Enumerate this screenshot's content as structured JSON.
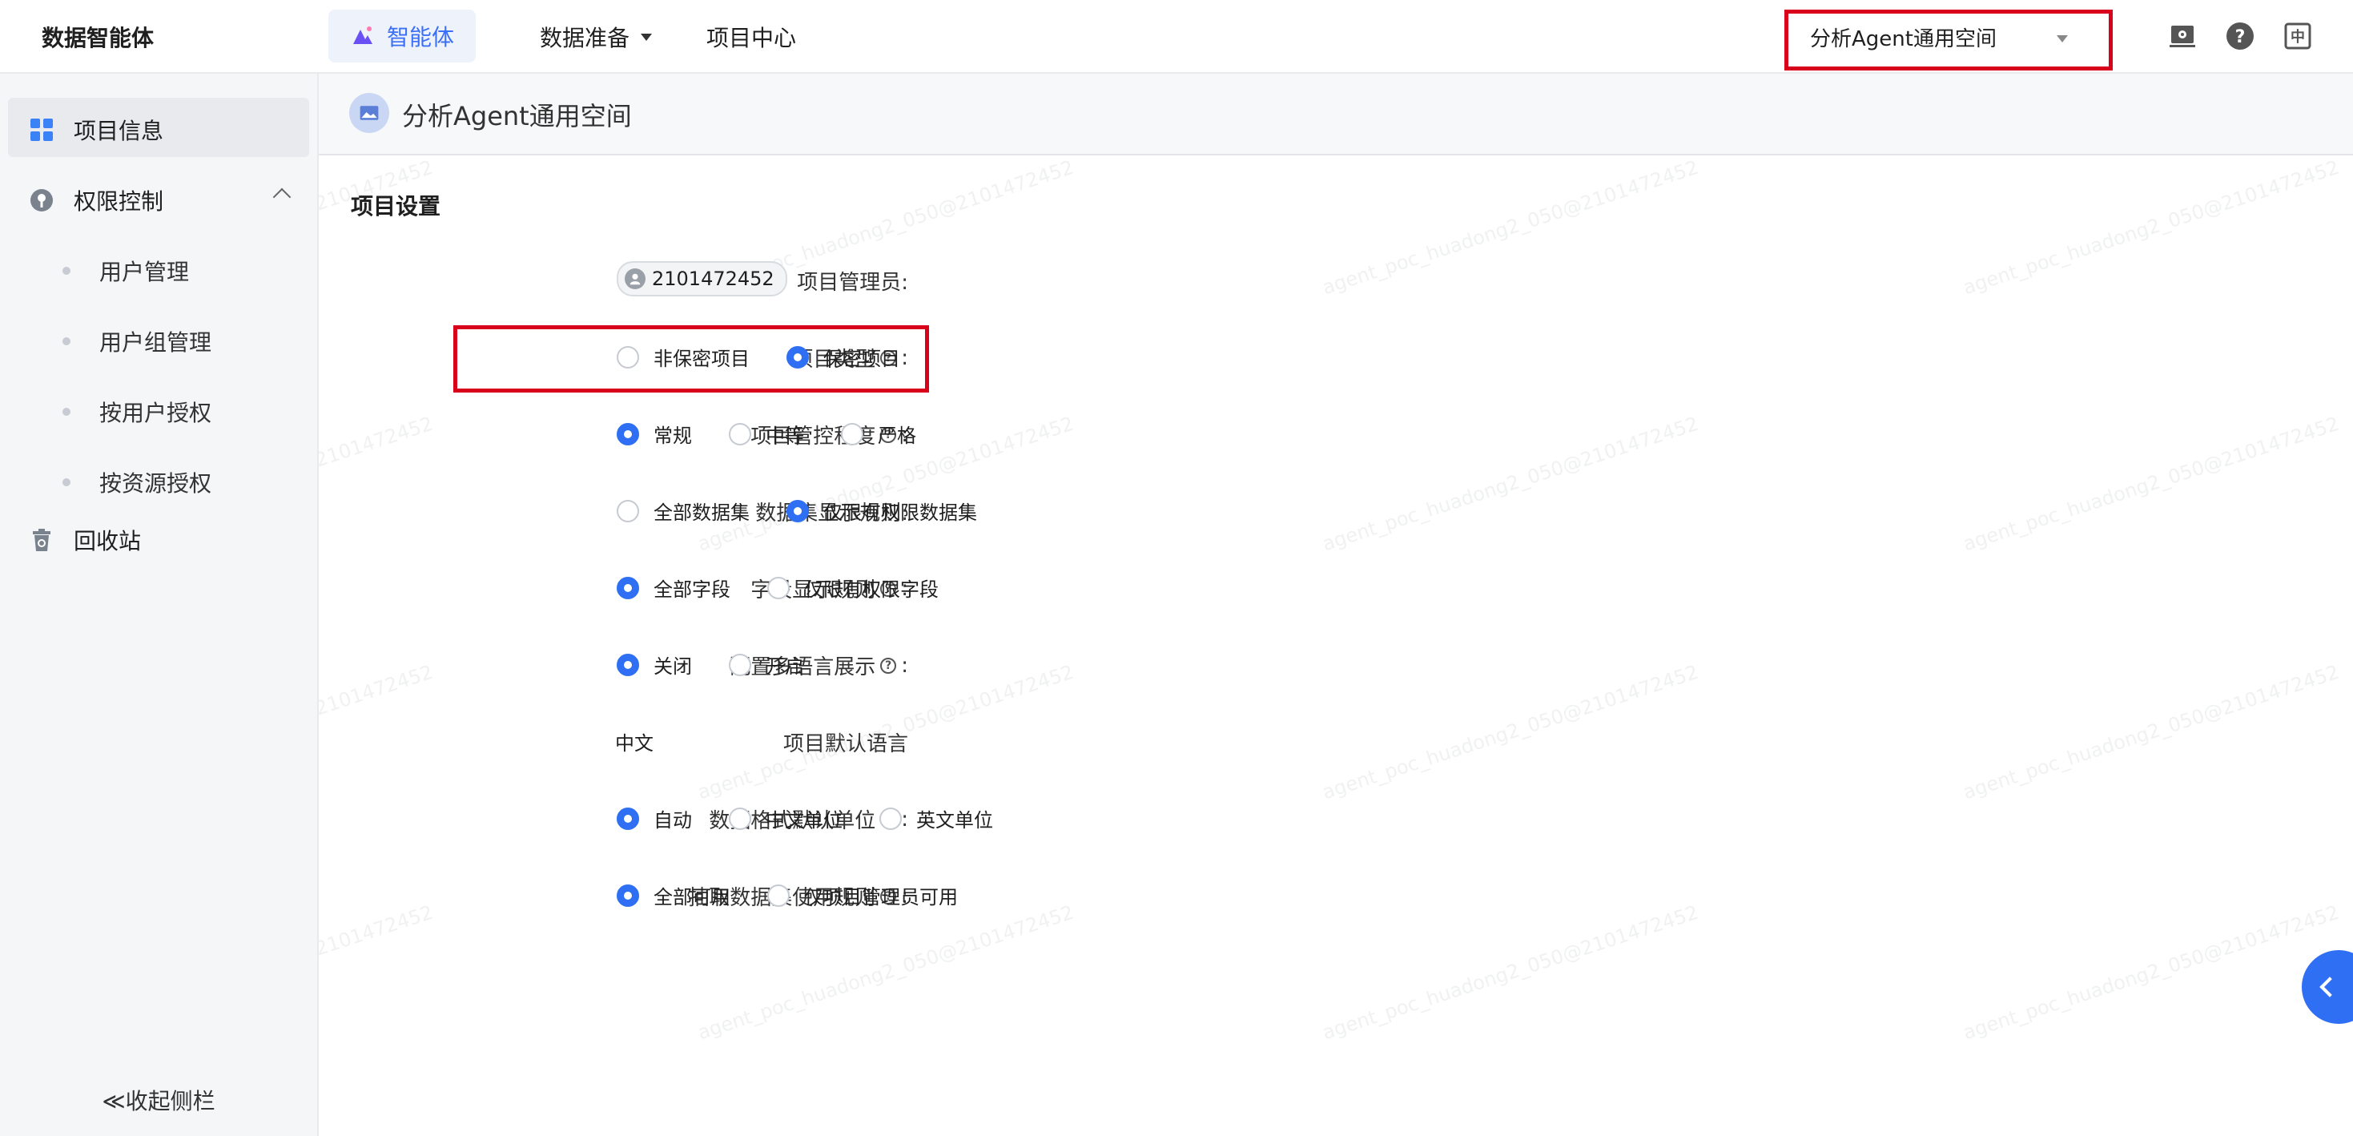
{
  "topbar": {
    "brand": "数据智能体",
    "agent_tab": "智能体",
    "data_prep": "数据准备",
    "project_center": "项目中心",
    "workspace_select": "分析Agent通用空间",
    "icons": [
      "monitor-settings-icon",
      "help-icon",
      "language-icon"
    ],
    "lang_label": "中"
  },
  "sidebar": {
    "project_info": "项目信息",
    "permission": "权限控制",
    "subs": [
      "用户管理",
      "用户组管理",
      "按用户授权",
      "按资源授权"
    ],
    "recycle": "回收站",
    "collapse": "≪收起侧栏"
  },
  "main": {
    "workspace_title": "分析Agent通用空间",
    "section_title": "项目设置",
    "admin_label": "项目管理员:",
    "admin_value": "2101472452",
    "type_label": "项目类型",
    "type_options": [
      "非保密项目",
      "保密项目"
    ],
    "control_label": "项目管控程度",
    "control_options": [
      "常规",
      "中等",
      "严格"
    ],
    "dataset_label": "数据集显示规则:",
    "dataset_options": [
      "全部数据集",
      "仅限有权限数据集"
    ],
    "field_label": "字段显示规则",
    "field_options": [
      "全部字段",
      "仅限有权限字段"
    ],
    "lang_label": "配置多语言展示",
    "lang_options": [
      "关闭",
      "开启"
    ],
    "default_lang_label": "项目默认语言",
    "default_lang_value": "中文",
    "unit_label": "数据格式默认单位",
    "unit_options": [
      "自动",
      "中文单位",
      "英文单位"
    ],
    "extract_label": "抽取数据集使用规则",
    "extract_options": [
      "全部可用",
      "仅项目管理员可用"
    ],
    "colon": ":"
  },
  "selected": {
    "type": 1,
    "control": 0,
    "dataset": 1,
    "field": 0,
    "lang": 0,
    "unit": 0,
    "extract": 0
  },
  "colors": {
    "accent": "#2f6ff3",
    "highlight": "#d9001b"
  }
}
